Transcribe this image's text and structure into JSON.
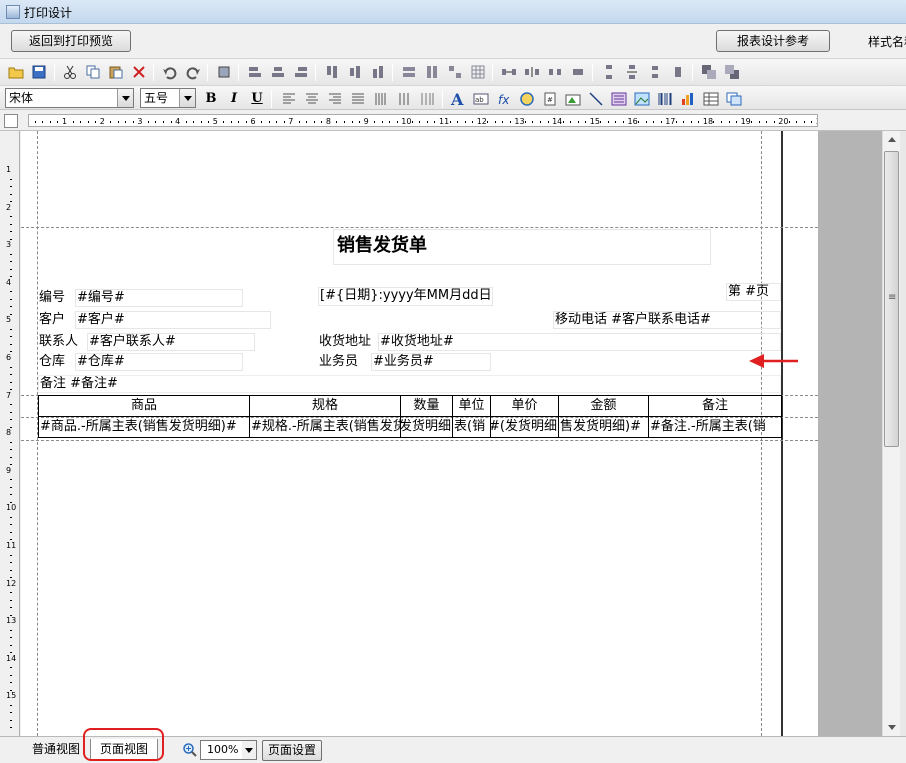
{
  "window": {
    "title": "打印设计"
  },
  "topbar": {
    "back_label": "返回到打印预览",
    "ref_label": "报表设计参考",
    "style_label": "样式名称"
  },
  "toolbar1": {
    "icons": [
      "open-folder-icon",
      "save-icon",
      "cut-icon",
      "copy-icon",
      "paste-icon",
      "delete-icon",
      "undo-icon",
      "redo-icon",
      "select-all-icon",
      "align-left-icon",
      "align-center-icon",
      "align-right-icon",
      "align-top-icon",
      "align-middle-icon",
      "align-bottom-icon",
      "same-width-icon",
      "same-height-icon",
      "same-size-icon",
      "grid-icon",
      "h-space-equal-icon",
      "h-space-increase-icon",
      "h-space-decrease-icon",
      "h-space-remove-icon",
      "v-space-equal-icon",
      "v-space-increase-icon",
      "v-space-decrease-icon",
      "v-space-remove-icon",
      "bring-front-icon",
      "send-back-icon"
    ]
  },
  "toolbar2": {
    "font_name": "宋体",
    "font_size": "五号",
    "bold": "B",
    "italic": "I",
    "underline": "U",
    "icons": [
      "text-align-left-icon",
      "text-align-center-icon",
      "text-align-right-icon",
      "text-justify-icon",
      "distribute-icon",
      "vertical-text-icon",
      "border-icon",
      "text-icon",
      "label-icon",
      "formula-icon",
      "system-var-icon",
      "page-num-icon",
      "image-frame-icon",
      "line-icon",
      "chart-icon",
      "picture-icon",
      "barcode-icon",
      "bar-chart-icon",
      "table-icon",
      "subreport-icon"
    ]
  },
  "ruler": {
    "h_labels": [
      "1",
      "2",
      "3",
      "4",
      "5",
      "6",
      "7",
      "8",
      "9",
      "10",
      "11",
      "12",
      "13",
      "14",
      "15",
      "16",
      "17",
      "18",
      "19",
      "20",
      "2"
    ],
    "v_labels": [
      "1",
      "2",
      "3",
      "4",
      "5",
      "6",
      "7",
      "8",
      "9",
      "10",
      "11",
      "12",
      "13",
      "14",
      "15"
    ]
  },
  "report": {
    "title": "销售发货单",
    "page_label": "第 #页",
    "no_label": "编号",
    "no_value": "#编号#",
    "date_value": "[#{日期}:yyyy年MM月dd日#]",
    "customer_label": "客户",
    "customer_value": "#客户#",
    "mobile_text": "移动电话 #客户联系电话#",
    "contact_label": "联系人",
    "contact_value": "#客户联系人#",
    "address_label": "收货地址",
    "address_value": "#收货地址#",
    "warehouse_label": "仓库",
    "warehouse_value": "#仓库#",
    "salesman_label": "业务员",
    "salesman_value": "#业务员#",
    "remark_text": "备注 #备注#",
    "columns": [
      "商品",
      "规格",
      "数量",
      "单位",
      "单价",
      "金额",
      "备注"
    ],
    "row": [
      "#商品.-所属主表(销售发货明细)#",
      "#规格.-所属主表(销售发货明细)#",
      "发货明细)#",
      "表(销",
      "发货明细)#",
      "售发货明细)#",
      "#备注.-所属主表(销"
    ]
  },
  "bottombar": {
    "tab_normal": "普通视图",
    "tab_page": "页面视图",
    "zoom": "100%",
    "page_setup": "页面设置"
  },
  "colors": {
    "highlight": "#e02020",
    "arrow": "#e02020"
  }
}
